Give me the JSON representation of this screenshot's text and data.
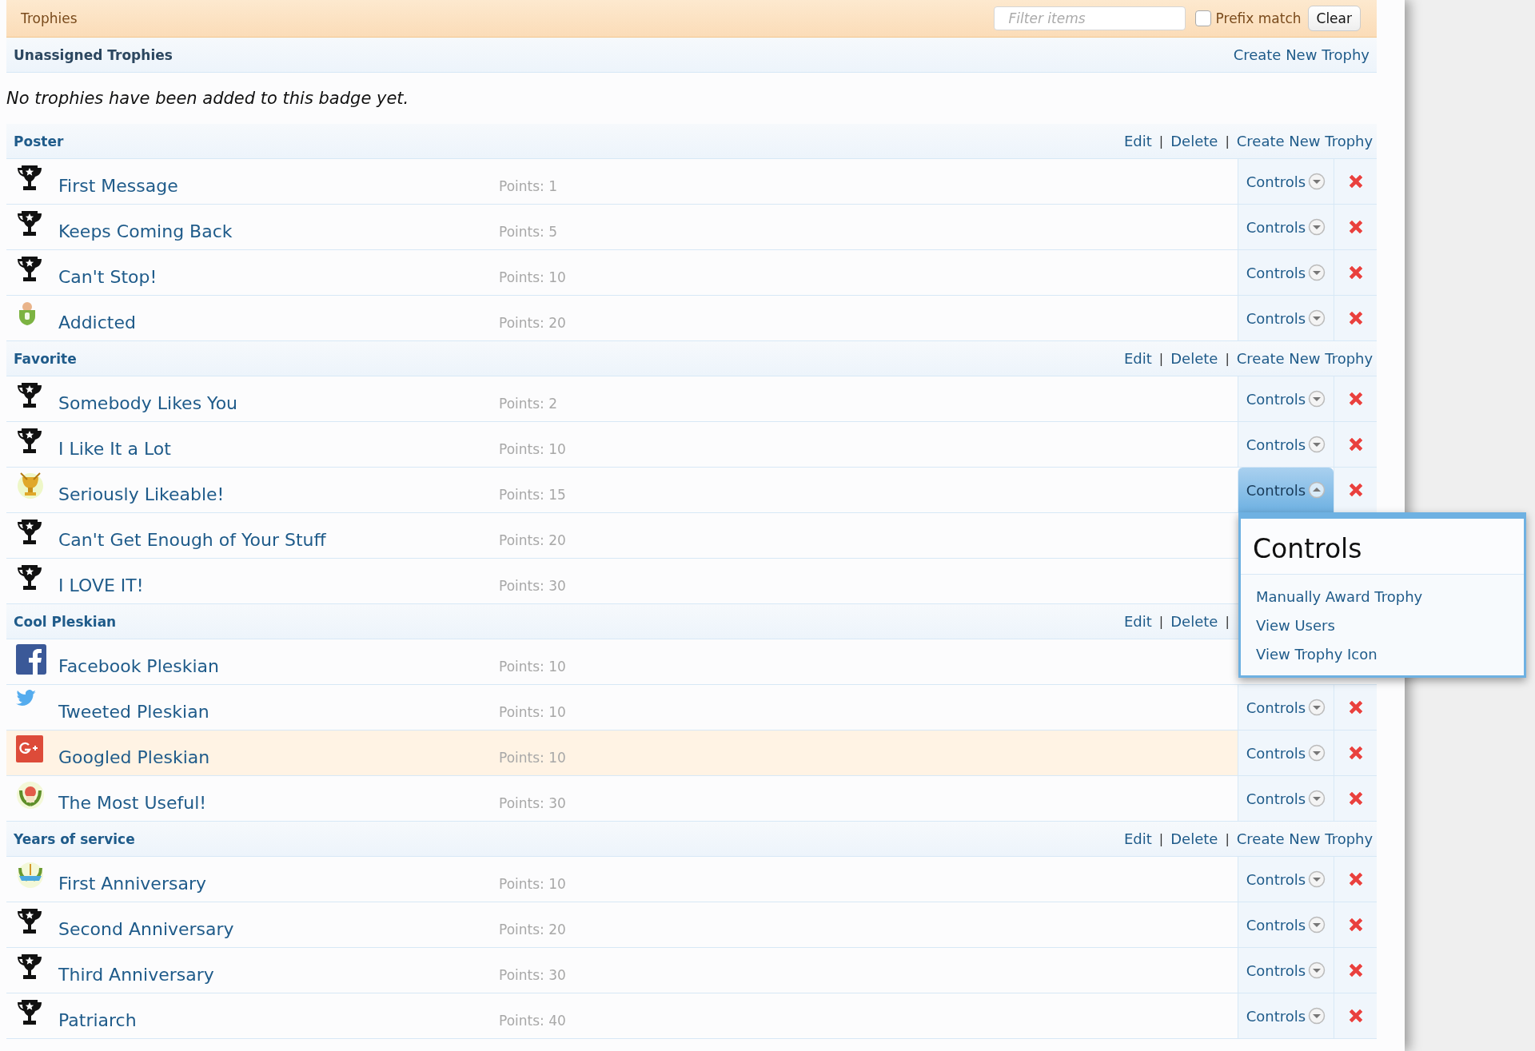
{
  "title_bar": {
    "title": "Trophies",
    "filter": {
      "placeholder": "Filter items"
    },
    "prefix_match": {
      "label": "Prefix match",
      "checked": false
    },
    "clear_button": "Clear"
  },
  "unassigned": {
    "title": "Unassigned Trophies",
    "links": [
      {
        "kind": "link",
        "text": "Create New Trophy"
      }
    ],
    "message": "No trophies have been added to this badge yet."
  },
  "groups": [
    {
      "title": "Poster",
      "links": [
        {
          "kind": "link",
          "text": "Edit"
        },
        {
          "kind": "separator",
          "text": "|"
        },
        {
          "kind": "link",
          "text": "Delete"
        },
        {
          "kind": "separator",
          "text": "|"
        },
        {
          "kind": "link",
          "text": "Create New Trophy"
        }
      ],
      "trophies": [
        {
          "kind": "trophy",
          "name": "First Message",
          "points": "Points: 1",
          "controls": "Controls",
          "highlighted": false,
          "menu_open": false,
          "covered": false
        },
        {
          "kind": "trophy",
          "name": "Keeps Coming Back",
          "points": "Points: 5",
          "controls": "Controls",
          "highlighted": false,
          "menu_open": false,
          "covered": false
        },
        {
          "kind": "trophy",
          "name": "Can't Stop!",
          "points": "Points: 10",
          "controls": "Controls",
          "highlighted": false,
          "menu_open": false,
          "covered": false
        },
        {
          "kind": "badge",
          "name": "Addicted",
          "points": "Points: 20",
          "controls": "Controls",
          "highlighted": false,
          "menu_open": false,
          "covered": false
        }
      ]
    },
    {
      "title": "Favorite",
      "links": [
        {
          "kind": "link",
          "text": "Edit"
        },
        {
          "kind": "separator",
          "text": "|"
        },
        {
          "kind": "link",
          "text": "Delete"
        },
        {
          "kind": "separator",
          "text": "|"
        },
        {
          "kind": "link",
          "text": "Create New Trophy"
        }
      ],
      "trophies": [
        {
          "kind": "trophy",
          "name": "Somebody Likes You",
          "points": "Points: 2",
          "controls": "Controls",
          "highlighted": false,
          "menu_open": false,
          "covered": false
        },
        {
          "kind": "trophy",
          "name": "I Like It a Lot",
          "points": "Points: 10",
          "controls": "Controls",
          "highlighted": false,
          "menu_open": false,
          "covered": false
        },
        {
          "kind": "cup",
          "name": "Seriously Likeable!",
          "points": "Points: 15",
          "controls": "Controls",
          "highlighted": false,
          "menu_open": true,
          "covered": false
        },
        {
          "kind": "trophy",
          "name": "Can't Get Enough of Your Stuff",
          "points": "Points: 20",
          "highlighted": false,
          "menu_open": false,
          "covered": true
        },
        {
          "kind": "trophy",
          "name": "I LOVE IT!",
          "points": "Points: 30",
          "highlighted": false,
          "menu_open": false,
          "covered": true
        }
      ]
    },
    {
      "title": "Cool Pleskian",
      "links": [
        {
          "kind": "link",
          "text": "Edit"
        },
        {
          "kind": "separator",
          "text": "|"
        },
        {
          "kind": "link",
          "text": "Delete"
        },
        {
          "kind": "separator",
          "text": "|"
        }
      ],
      "trophies": [
        {
          "kind": "f-logo",
          "name": "Facebook Pleskian",
          "points": "Points: 10",
          "highlighted": false,
          "menu_open": false,
          "covered": true
        },
        {
          "kind": "bird",
          "name": "Tweeted Pleskian",
          "points": "Points: 10",
          "controls": "Controls",
          "highlighted": false,
          "menu_open": false,
          "covered": false
        },
        {
          "kind": "g-plus",
          "name": "Googled Pleskian",
          "points": "Points: 10",
          "controls": "Controls",
          "highlighted": true,
          "menu_open": false,
          "covered": false
        },
        {
          "kind": "wreath",
          "name": "The Most Useful!",
          "points": "Points: 30",
          "controls": "Controls",
          "highlighted": false,
          "menu_open": false,
          "covered": false
        }
      ]
    },
    {
      "title": "Years of service",
      "links": [
        {
          "kind": "link",
          "text": "Edit"
        },
        {
          "kind": "separator",
          "text": "|"
        },
        {
          "kind": "link",
          "text": "Delete"
        },
        {
          "kind": "separator",
          "text": "|"
        },
        {
          "kind": "link",
          "text": "Create New Trophy"
        }
      ],
      "trophies": [
        {
          "kind": "ribbon",
          "name": "First Anniversary",
          "points": "Points: 10",
          "controls": "Controls",
          "highlighted": false,
          "menu_open": false,
          "covered": false
        },
        {
          "kind": "trophy",
          "name": "Second Anniversary",
          "points": "Points: 20",
          "controls": "Controls",
          "highlighted": false,
          "menu_open": false,
          "covered": false
        },
        {
          "kind": "trophy",
          "name": "Third Anniversary",
          "points": "Points: 30",
          "controls": "Controls",
          "highlighted": false,
          "menu_open": false,
          "covered": false
        },
        {
          "kind": "trophy",
          "name": "Patriarch",
          "points": "Points: 40",
          "controls": "Controls",
          "highlighted": false,
          "menu_open": false,
          "covered": false
        }
      ]
    }
  ],
  "controls_menu": {
    "title": "Controls",
    "items": [
      "Manually Award Trophy",
      "View Users",
      "View Trophy Icon"
    ]
  }
}
